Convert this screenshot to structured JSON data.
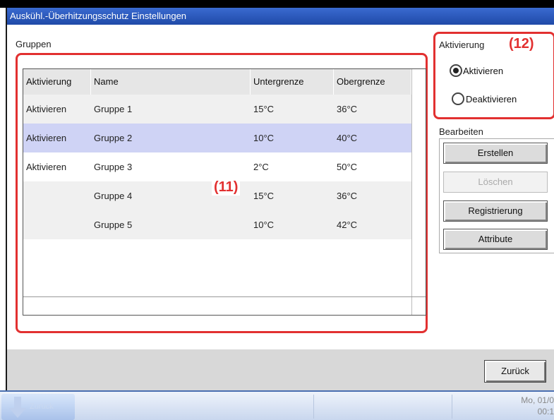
{
  "window": {
    "title": "Auskühl.-Überhitzungsschutz Einstellungen"
  },
  "groups_panel": {
    "label": "Gruppen",
    "columns": [
      "Aktivierung",
      "Name",
      "Untergrenze",
      "Obergrenze"
    ],
    "rows": [
      {
        "activation": "Aktivieren",
        "name": "Gruppe 1",
        "lower": "15°C",
        "upper": "36°C",
        "selected": false
      },
      {
        "activation": "Aktivieren",
        "name": "Gruppe 2",
        "lower": "10°C",
        "upper": "40°C",
        "selected": true
      },
      {
        "activation": "Aktivieren",
        "name": "Gruppe 3",
        "lower": "2°C",
        "upper": "50°C",
        "selected": false
      },
      {
        "activation": "",
        "name": "Gruppe 4",
        "lower": "15°C",
        "upper": "36°C",
        "selected": false
      },
      {
        "activation": "",
        "name": "Gruppe 5",
        "lower": "10°C",
        "upper": "42°C",
        "selected": false
      }
    ],
    "callout": "(11)"
  },
  "activation_panel": {
    "label": "Aktivierung",
    "callout": "(12)",
    "options": [
      {
        "label": "Aktivieren",
        "checked": true
      },
      {
        "label": "Deaktivieren",
        "checked": false
      }
    ]
  },
  "edit_panel": {
    "label": "Bearbeiten",
    "buttons": [
      {
        "label": "Erstellen",
        "enabled": true
      },
      {
        "label": "Löschen",
        "enabled": false
      },
      {
        "label": "Registrierung",
        "enabled": true
      },
      {
        "label": "Attribute",
        "enabled": true
      }
    ]
  },
  "footer": {
    "back_label": "Zurück"
  },
  "taskbar": {
    "back_label": "Zurück",
    "clock_line1": "Mo, 01/0",
    "clock_line2": "00:1"
  },
  "colors": {
    "highlight": "#e23030",
    "selected_row": "#cfd3f5",
    "titlebar": "#2a57bb"
  }
}
